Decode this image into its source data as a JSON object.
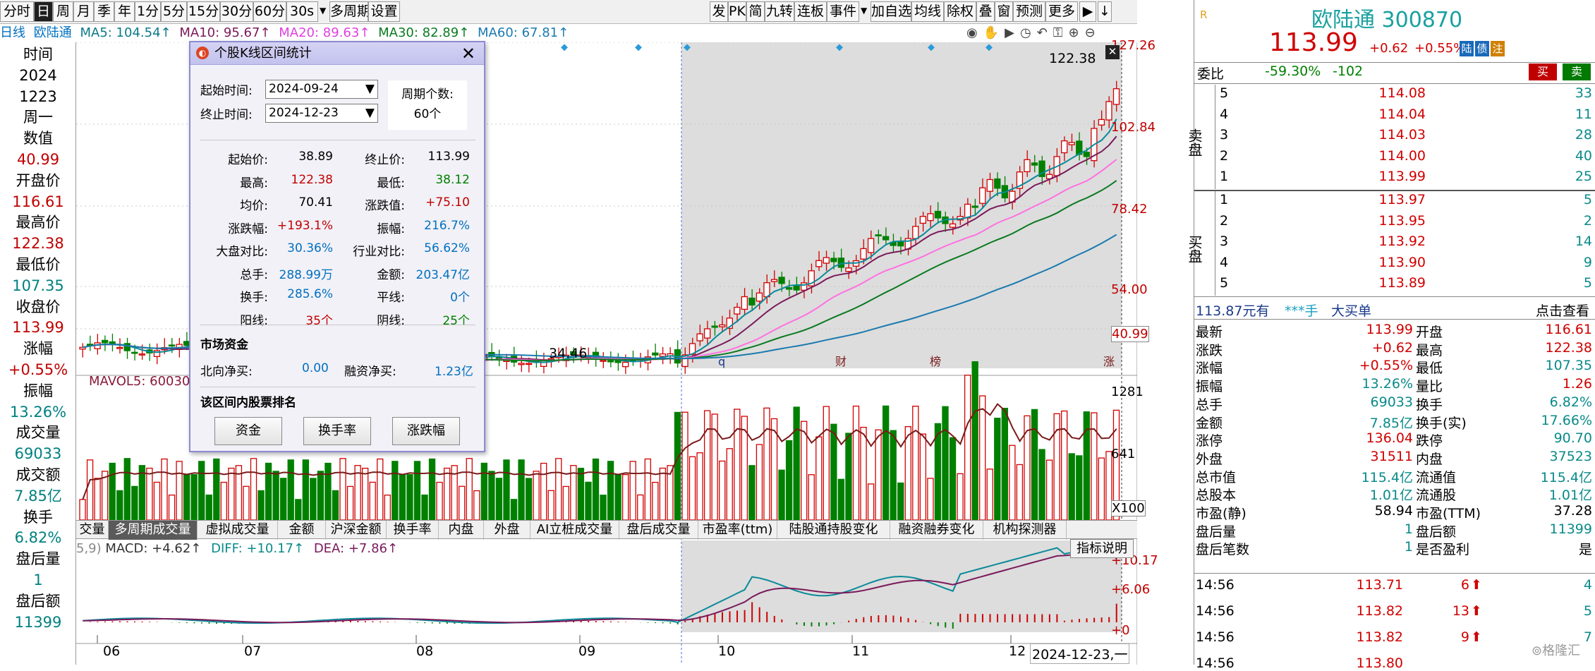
{
  "toolbar": {
    "left": [
      "分时",
      "日",
      "周",
      "月",
      "季",
      "年",
      "1分",
      "5分",
      "15分",
      "30分",
      "60分",
      "30s",
      "多周期",
      "设置"
    ],
    "right": [
      "发",
      "PK",
      "简",
      "九转",
      "连板",
      "事件",
      "加自选",
      "均线",
      "除权",
      "叠",
      "窗",
      "预测",
      "更多"
    ]
  },
  "ma_line": {
    "period": "日线",
    "stock": "欧陆通",
    "ma5": "MA5: 104.54↑",
    "ma10": "MA10: 95.67↑",
    "ma20": "MA20: 89.63↑",
    "ma30": "MA30: 82.89↑",
    "ma60": "MA60: 67.81↑"
  },
  "left_col": [
    {
      "t": "时间",
      "c": "#000000"
    },
    {
      "t": "2024",
      "c": "#000000"
    },
    {
      "t": "1223",
      "c": "#000000"
    },
    {
      "t": "周一",
      "c": "#000000"
    },
    {
      "t": "数值",
      "c": "#000000"
    },
    {
      "t": "40.99",
      "c": "#c00000"
    },
    {
      "t": "开盘价",
      "c": "#000000"
    },
    {
      "t": "116.61",
      "c": "#c00000"
    },
    {
      "t": "最高价",
      "c": "#000000"
    },
    {
      "t": "122.38",
      "c": "#c00000"
    },
    {
      "t": "最低价",
      "c": "#000000"
    },
    {
      "t": "107.35",
      "c": "#008080"
    },
    {
      "t": "收盘价",
      "c": "#000000"
    },
    {
      "t": "113.99",
      "c": "#c00000"
    },
    {
      "t": "涨幅",
      "c": "#000000"
    },
    {
      "t": "+0.55%",
      "c": "#c00000"
    },
    {
      "t": "振幅",
      "c": "#000000"
    },
    {
      "t": "13.26%",
      "c": "#008080"
    },
    {
      "t": "成交量",
      "c": "#000000"
    },
    {
      "t": "69033",
      "c": "#008080"
    },
    {
      "t": "成交额",
      "c": "#000000"
    },
    {
      "t": "7.85亿",
      "c": "#008080"
    },
    {
      "t": "换手",
      "c": "#000000"
    },
    {
      "t": "6.82%",
      "c": "#008080"
    },
    {
      "t": "盘后量",
      "c": "#000000"
    },
    {
      "t": "1",
      "c": "#008080"
    },
    {
      "t": "盘后额",
      "c": "#000000"
    },
    {
      "t": "11399",
      "c": "#008080"
    }
  ],
  "price_axis": [
    "127.26",
    "102.84",
    "78.42",
    "54.00",
    "40.99"
  ],
  "vol_axis": [
    "1281",
    "641",
    "X100"
  ],
  "macd_axis": [
    "+10.17",
    "+6.06",
    "+0"
  ],
  "chart_labels": {
    "high": "122.38",
    "low": "34.46",
    "mavol": "MAVOL5: 60030",
    "macd_prefix": "5,9)",
    "macd": "MACD: +4.62↑",
    "diff": "DIFF: +10.17↑",
    "dea": "DEA: +7.86↑",
    "ind_btn": "指标说明"
  },
  "markers": {
    "q": "q",
    "cai": "财",
    "bang": "榜",
    "zhang": "涨"
  },
  "months": [
    "06",
    "07",
    "08",
    "09",
    "10",
    "11",
    "12",
    "2024-12-23,一"
  ],
  "ind_tabs": [
    "交量",
    "多周期成交量",
    "虚拟成交量",
    "金额",
    "沪深金额",
    "换手率",
    "内盘",
    "外盘",
    "AI立桩成交量",
    "盘后成交量",
    "市盈率(ttm)",
    "陆股通持股变化",
    "融资融券变化",
    "机构探测器"
  ],
  "dialog": {
    "title": "个股K线区间统计",
    "start_label": "起始时间:",
    "start_value": "2024-09-24",
    "end_label": "终止时间:",
    "end_value": "2024-12-23",
    "period_label": "周期个数:",
    "period_value": "60个",
    "stats": [
      [
        "起始价:",
        "38.89",
        "终止价:",
        "113.99"
      ],
      [
        "最高:",
        "122.38",
        "最低:",
        "38.12"
      ],
      [
        "均价:",
        "70.41",
        "涨跌值:",
        "+75.10"
      ],
      [
        "涨跌幅:",
        "+193.1%",
        "振幅:",
        "216.7%"
      ],
      [
        "大盘对比:",
        "30.36%",
        "行业对比:",
        "56.62%"
      ],
      [
        "总手:",
        "288.99万",
        "金额:",
        "203.47亿"
      ],
      [
        "换手:",
        "285.6%",
        "平线:",
        "0个"
      ],
      [
        "阳线:",
        "35个",
        "阴线:",
        "25个"
      ]
    ],
    "fund_title": "市场资金",
    "north_label": "北向净买:",
    "north_value": "0.00",
    "margin_label": "融资净买:",
    "margin_value": "1.23亿",
    "rank_title": "该区间内股票排名",
    "btn_fund": "资金",
    "btn_turnover": "换手率",
    "btn_change": "涨跌幅"
  },
  "quote": {
    "logo": "R",
    "name": "欧陆通 300870",
    "price": "113.99",
    "change": "+0.62",
    "pct": "+0.55%",
    "tags": [
      "陆",
      "债",
      "注"
    ],
    "wb_label": "委比",
    "wb": "-59.30%",
    "wc": "-102",
    "buy": "买",
    "sell": "卖",
    "sell_side": "卖盘",
    "buy_side": "买盘",
    "asks": [
      [
        "5",
        "114.08",
        "33"
      ],
      [
        "4",
        "114.04",
        "11"
      ],
      [
        "3",
        "114.03",
        "28"
      ],
      [
        "2",
        "114.00",
        "40"
      ],
      [
        "1",
        "113.99",
        "25"
      ]
    ],
    "bids": [
      [
        "1",
        "113.97",
        "5"
      ],
      [
        "2",
        "113.95",
        "2"
      ],
      [
        "3",
        "113.92",
        "14"
      ],
      [
        "4",
        "113.90",
        "9"
      ],
      [
        "5",
        "113.89",
        "5"
      ]
    ],
    "bar_price": "113.87元有",
    "bar_mask": "***手",
    "bar_big": "大买单",
    "bar_view": "点击查看",
    "stats": [
      [
        "最新",
        "113.99",
        "开盘",
        "116.61"
      ],
      [
        "涨跌",
        "+0.62",
        "最高",
        "122.38"
      ],
      [
        "涨幅",
        "+0.55%",
        "最低",
        "107.35"
      ],
      [
        "振幅",
        "13.26%",
        "量比",
        "1.26"
      ],
      [
        "总手",
        "69033",
        "换手",
        "6.82%"
      ],
      [
        "金额",
        "7.85亿",
        "换手(实)",
        "17.66%"
      ],
      [
        "涨停",
        "136.04",
        "跌停",
        "90.70"
      ],
      [
        "外盘",
        "31511",
        "内盘",
        "37523"
      ],
      [
        "总市值",
        "115.4亿",
        "流通值",
        "115.4亿"
      ],
      [
        "总股本",
        "1.01亿",
        "流通股",
        "1.01亿"
      ],
      [
        "市盈(静)",
        "58.94",
        "市盈(TTM)",
        "37.28"
      ],
      [
        "盘后量",
        "1",
        "盘后额",
        "11399"
      ],
      [
        "盘后笔数",
        "1",
        "是否盈利",
        "是"
      ]
    ],
    "ticks": [
      [
        "14:56",
        "113.71",
        "6",
        "4"
      ],
      [
        "14:56",
        "113.82",
        "13",
        "5"
      ],
      [
        "14:56",
        "113.82",
        "9",
        "7"
      ],
      [
        "14:56",
        "113.80",
        "",
        ""
      ]
    ],
    "watermark": "格隆汇"
  },
  "chart_data": {
    "type": "candlestick",
    "title": "欧陆通 日线",
    "price_ylim": [
      34,
      127.26
    ],
    "x_months": [
      "06",
      "07",
      "08",
      "09",
      "10",
      "11",
      "12"
    ],
    "selected_range": [
      "2024-09-24",
      "2024-12-23"
    ],
    "ma_values_last": {
      "MA5": 104.54,
      "MA10": 95.67,
      "MA20": 89.63,
      "MA30": 82.89,
      "MA60": 67.81
    },
    "last_bar": {
      "date": "2024-12-23",
      "open": 116.61,
      "high": 122.38,
      "low": 107.35,
      "close": 113.99
    },
    "range_high": 122.38,
    "range_low_label": 34.46,
    "volume_ylim": [
      0,
      1281
    ],
    "macd": {
      "MACD": 4.62,
      "DIFF": 10.17,
      "DEA": 7.86,
      "ylim": [
        0,
        10.17
      ]
    }
  }
}
